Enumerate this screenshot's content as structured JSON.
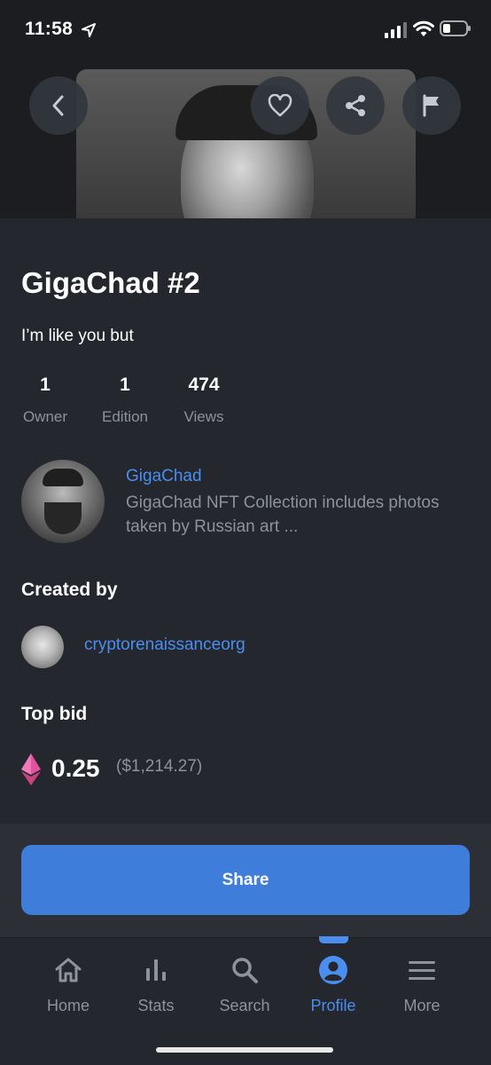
{
  "status_bar": {
    "time": "11:58"
  },
  "nft": {
    "title": "GigaChad #2",
    "description": "I’m like you but"
  },
  "stats": [
    {
      "value": "1",
      "label": "Owner"
    },
    {
      "value": "1",
      "label": "Edition"
    },
    {
      "value": "474",
      "label": "Views"
    }
  ],
  "collection": {
    "name": "GigaChad",
    "description": "GigaChad NFT Collection includes photos taken by Russian art ..."
  },
  "created_by": {
    "heading": "Created by",
    "name": "cryptorenaissanceorg"
  },
  "top_bid": {
    "heading": "Top bid",
    "amount": "0.25",
    "usd": "($1,214.27)"
  },
  "actions": {
    "share_label": "Share"
  },
  "tabs": [
    {
      "label": "Home",
      "icon": "home-icon"
    },
    {
      "label": "Stats",
      "icon": "stats-icon"
    },
    {
      "label": "Search",
      "icon": "search-icon"
    },
    {
      "label": "Profile",
      "icon": "profile-icon",
      "active": true
    },
    {
      "label": "More",
      "icon": "menu-icon"
    }
  ],
  "colors": {
    "accent": "#4a8ef0",
    "button": "#3f7ddb",
    "background": "#24272d",
    "eth": "#e0529c"
  }
}
